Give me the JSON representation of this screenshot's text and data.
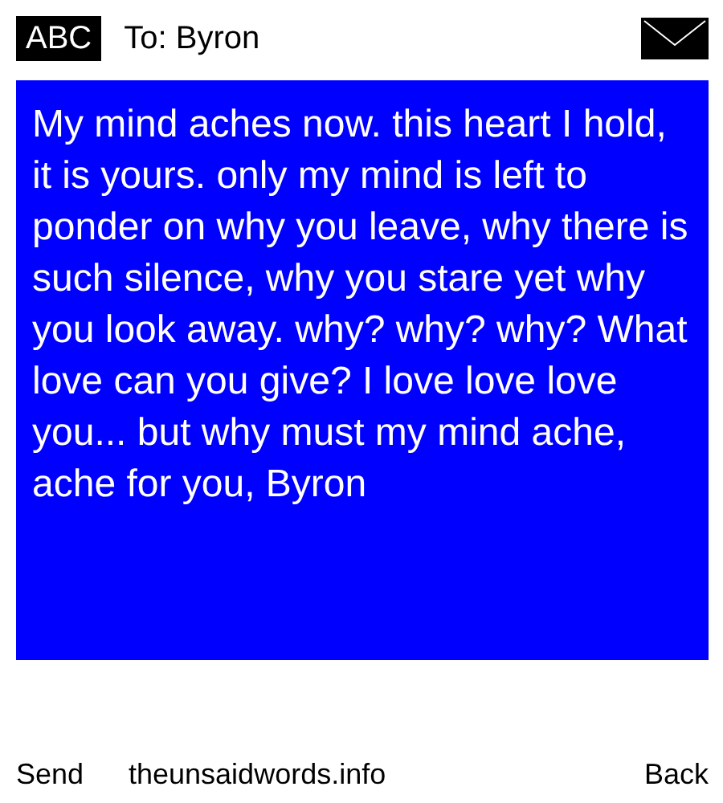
{
  "header": {
    "input_mode": "ABC",
    "recipient": "To: Byron"
  },
  "message": {
    "text": "My mind aches now. this heart I hold, it is yours. only my mind is left to ponder on why you leave, why there is such silence, why you stare yet why you look away. why? why? why? What love can you give? I love love love you... but why must my mind ache, ache for you, Byron"
  },
  "softkeys": {
    "left": "Send",
    "center": "theunsaidwords.info",
    "right": "Back"
  }
}
